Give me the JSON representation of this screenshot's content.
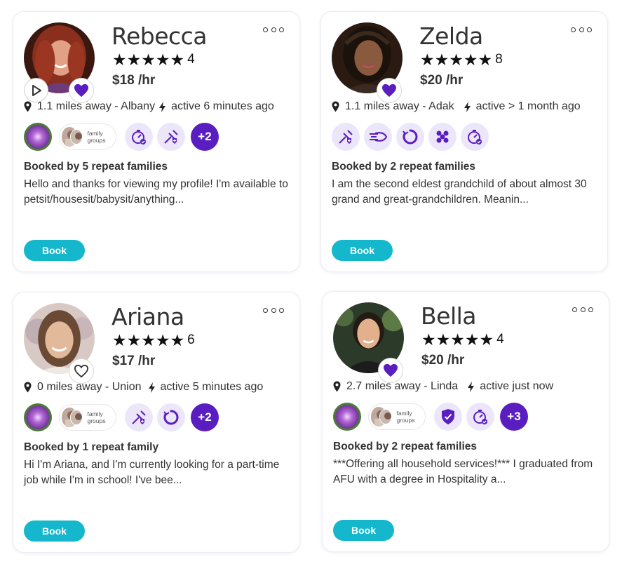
{
  "cards": [
    {
      "name": "Rebecca",
      "stars": "★★★★★",
      "rating_count": "4",
      "rate": "$18 /hr",
      "distance": "1.1 miles away - Albany",
      "activity": "active 6 minutes ago",
      "has_video": true,
      "favorited": true,
      "family_groups_label": "family groups",
      "badge_icons": [
        "needle-shield-icon",
        "timer-check-icon"
      ],
      "more_badges": "+2",
      "booked": "Booked by 5 repeat families",
      "bio": "Hello and thanks for viewing my profile! I'm available to petsit/housesit/babysit/anything...",
      "book_label": "Book"
    },
    {
      "name": "Zelda",
      "stars": "★★★★★",
      "rating_count": "8",
      "rate": "$20 /hr",
      "distance": "1.1 miles away - Adak",
      "activity": "active > 1 month ago",
      "has_video": false,
      "favorited": true,
      "badge_icons": [
        "needle-shield-icon",
        "speed-icon",
        "refresh-icon",
        "paw-cluster-icon",
        "timer-check-icon"
      ],
      "booked": "Booked by 2 repeat families",
      "bio": "I am the second eldest grandchild of about almost 30 grand and great-grandchildren. Meanin...",
      "book_label": "Book"
    },
    {
      "name": "Ariana",
      "stars": "★★★★★",
      "rating_count": "6",
      "rate": "$17 /hr",
      "distance": "0 miles away - Union",
      "activity": "active 5 minutes ago",
      "has_video": false,
      "favorited": false,
      "family_groups_label": "family groups",
      "badge_icons": [
        "needle-shield-icon",
        "refresh-icon"
      ],
      "more_badges": "+2",
      "booked": "Booked by 1 repeat family",
      "bio": "Hi I'm Ariana, and I'm currently looking for a part-time job while I'm in school! I've bee...",
      "book_label": "Book"
    },
    {
      "name": "Bella",
      "stars": "★★★★★",
      "rating_count": "4",
      "rate": "$20 /hr",
      "distance": "2.7 miles away - Linda",
      "activity": "active just now",
      "has_video": false,
      "favorited": true,
      "family_groups_label": "family groups",
      "badge_icons": [
        "shield-check-icon",
        "timer-check-icon"
      ],
      "more_badges": "+3",
      "booked": "Booked by 2 repeat families",
      "bio": "***Offering all household services!*** I graduated from AFU with a degree in Hospitality a...",
      "book_label": "Book"
    }
  ],
  "colors": {
    "accent": "#5a1ec0",
    "badge_bg": "#ece6fa",
    "book_button": "#14b7cc"
  }
}
